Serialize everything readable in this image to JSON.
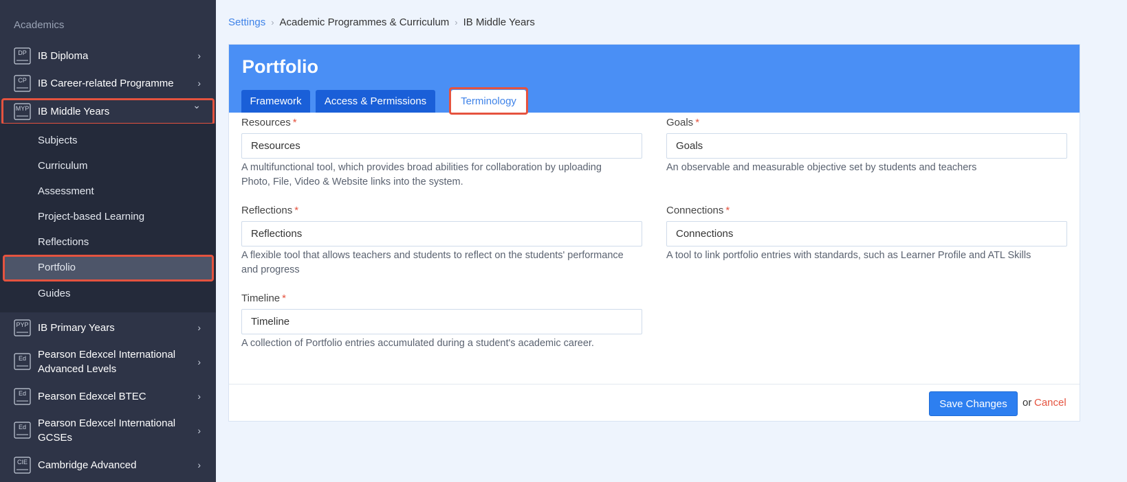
{
  "sidebar": {
    "heading": "Academics",
    "items": [
      {
        "icon": "DP",
        "label": "IB Diploma"
      },
      {
        "icon": "CP",
        "label": "IB Career-related Programme"
      },
      {
        "icon": "MYP",
        "label": "IB Middle Years"
      },
      {
        "icon": "PYP",
        "label": "IB Primary Years"
      },
      {
        "icon": "Ed",
        "label": "Pearson Edexcel International Advanced Levels"
      },
      {
        "icon": "Ed",
        "label": "Pearson Edexcel BTEC"
      },
      {
        "icon": "Ed",
        "label": "Pearson Edexcel International GCSEs"
      },
      {
        "icon": "CIE",
        "label": "Cambridge Advanced"
      }
    ],
    "subitems": [
      "Subjects",
      "Curriculum",
      "Assessment",
      "Project-based Learning",
      "Reflections",
      "Portfolio",
      "Guides"
    ],
    "chevron_right": "›",
    "chevron_down": "⌄"
  },
  "breadcrumb": {
    "items": [
      "Settings",
      "Academic Programmes & Curriculum",
      "IB Middle Years"
    ],
    "sep": "›"
  },
  "card": {
    "title": "Portfolio",
    "tabs": [
      "Framework",
      "Access & Permissions",
      "Terminology"
    ],
    "required_mark": "*",
    "fields": [
      {
        "label": "Resources",
        "value": "Resources",
        "help": "A multifunctional tool, which provides broad abilities for collaboration by uploading Photo, File, Video & Website links into the system."
      },
      {
        "label": "Goals",
        "value": "Goals",
        "help": "An observable and measurable objective set by students and teachers"
      },
      {
        "label": "Reflections",
        "value": "Reflections",
        "help": "A flexible tool that allows teachers and students to reflect on the students' performance and progress"
      },
      {
        "label": "Connections",
        "value": "Connections",
        "help": "A tool to link portfolio entries with standards, such as Learner Profile and ATL Skills"
      },
      {
        "label": "Timeline",
        "value": "Timeline",
        "help": "A collection of Portfolio entries accumulated during a student's academic career."
      }
    ],
    "save_label": "Save Changes",
    "or_text": "or",
    "cancel_label": "Cancel"
  },
  "colors": {
    "accent": "#4a8ff5",
    "highlight": "#e5533f",
    "sidebar_bg": "#2e3447"
  }
}
